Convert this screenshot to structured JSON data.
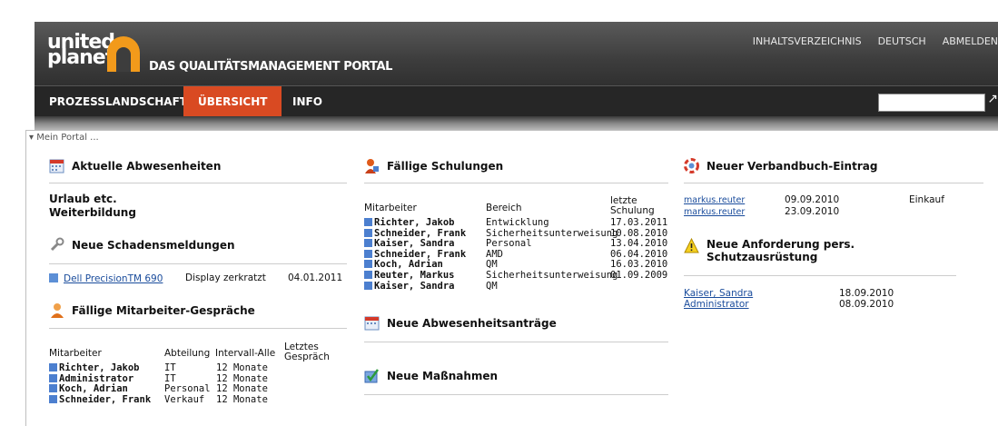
{
  "header": {
    "logo_line1": "united",
    "logo_line2": "planet",
    "portal_title": "DAS QUALITÄTSMANAGEMENT PORTAL",
    "links": [
      "INHALTSVERZEICHNIS",
      "DEUTSCH",
      "ABMELDEN"
    ]
  },
  "nav": {
    "items": [
      "PROZESSLANDSCHAFT",
      "ÜBERSICHT",
      "INFO"
    ],
    "active": "ÜBERSICHT",
    "search_value": ""
  },
  "portal": {
    "breadcrumb": "▾ Mein Portal ...",
    "abwesenheiten": {
      "title": "Aktuelle Abwesenheiten",
      "lines": [
        "Urlaub etc.",
        "Weiterbildung"
      ]
    },
    "schaden": {
      "title": "Neue Schadensmeldungen",
      "row": {
        "item": "Dell PrecisionTM 690",
        "desc": "Display zerkratzt",
        "date": "04.01.2011"
      }
    },
    "gespraeche": {
      "title": "Fällige Mitarbeiter-Gespräche",
      "headers": [
        "Mitarbeiter",
        "Abteilung",
        "Intervall-Alle",
        "Letztes Gespräch"
      ],
      "rows": [
        {
          "name": "Richter, Jakob",
          "dept": "IT",
          "interval": "12 Monate"
        },
        {
          "name": "Administrator",
          "dept": "IT",
          "interval": "12 Monate"
        },
        {
          "name": "Koch, Adrian",
          "dept": "Personal",
          "interval": "12 Monate"
        },
        {
          "name": "Schneider, Frank",
          "dept": "Verkauf",
          "interval": "12 Monate"
        }
      ]
    },
    "schulungen": {
      "title": "Fällige Schulungen",
      "headers": [
        "Mitarbeiter",
        "Bereich",
        "letzte Schulung"
      ],
      "rows": [
        {
          "name": "Richter, Jakob",
          "area": "Entwicklung",
          "date": "17.03.2011"
        },
        {
          "name": "Schneider, Frank",
          "area": "Sicherheitsunterweisung",
          "date": "10.08.2010"
        },
        {
          "name": "Kaiser, Sandra",
          "area": "Personal",
          "date": "13.04.2010"
        },
        {
          "name": "Schneider, Frank",
          "area": "AMD",
          "date": "06.04.2010"
        },
        {
          "name": "Koch, Adrian",
          "area": "QM",
          "date": "16.03.2010"
        },
        {
          "name": "Reuter, Markus",
          "area": "Sicherheitsunterweisung",
          "date": "01.09.2009"
        },
        {
          "name": "Kaiser, Sandra",
          "area": "QM",
          "date": ""
        }
      ]
    },
    "abwesenheitsantraege": {
      "title": "Neue Abwesenheitsanträge"
    },
    "massnahmen": {
      "title": "Neue Maßnahmen"
    },
    "verbandbuch": {
      "title": "Neuer Verbandbuch-Eintrag",
      "rows": [
        {
          "user": "markus.reuter",
          "date": "09.09.2010",
          "dept": "Einkauf"
        },
        {
          "user": "markus.reuter",
          "date": "23.09.2010",
          "dept": ""
        }
      ]
    },
    "schutz": {
      "title_line1": "Neue Anforderung pers.",
      "title_line2": "Schutzausrüstung",
      "rows": [
        {
          "user": "Kaiser, Sandra",
          "date": "18.09.2010"
        },
        {
          "user": "Administrator",
          "date": "08.09.2010"
        }
      ]
    }
  }
}
